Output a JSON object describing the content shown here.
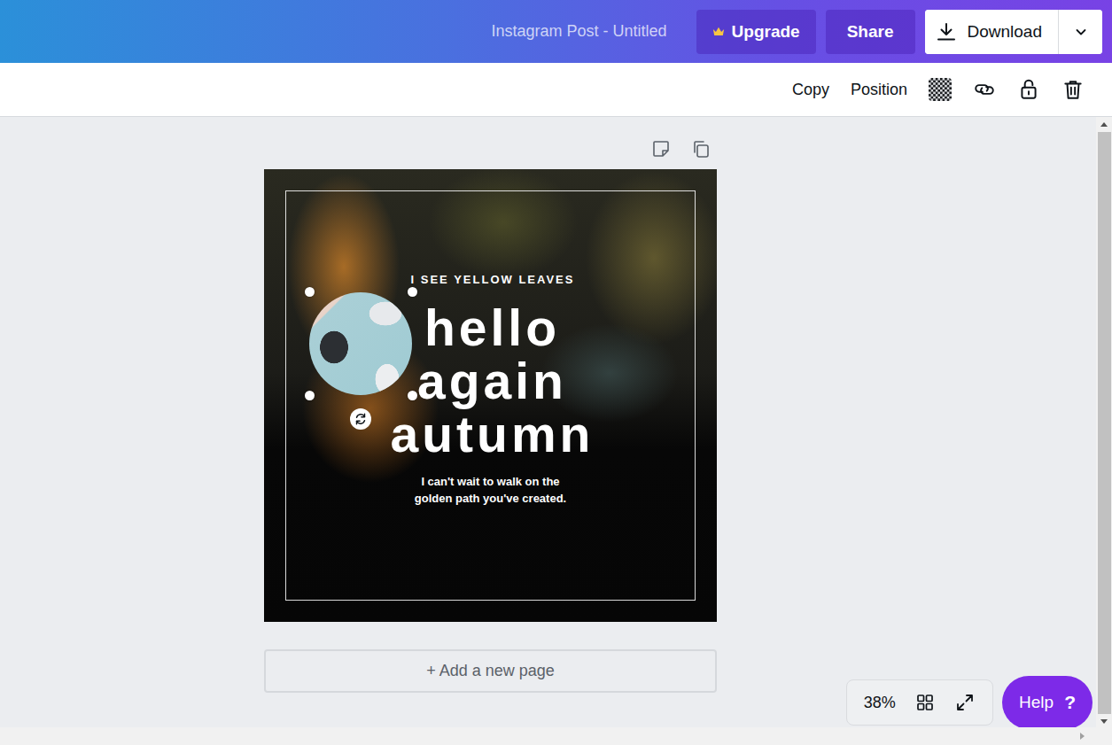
{
  "header": {
    "title": "Instagram Post - Untitled",
    "upgrade": "Upgrade",
    "share": "Share",
    "download": "Download"
  },
  "toolbar": {
    "items": [
      "Copy",
      "Position"
    ]
  },
  "design": {
    "subtitle": "I SEE YELLOW LEAVES",
    "headline": [
      "hello",
      "again",
      "autumn"
    ],
    "body": [
      "I can't wait to walk on the",
      "golden path you've created."
    ],
    "image": {
      "selected": true
    }
  },
  "add_page": "+ Add a new page",
  "zoom": "38%",
  "help": {
    "label": "Help",
    "icon": "?"
  }
}
